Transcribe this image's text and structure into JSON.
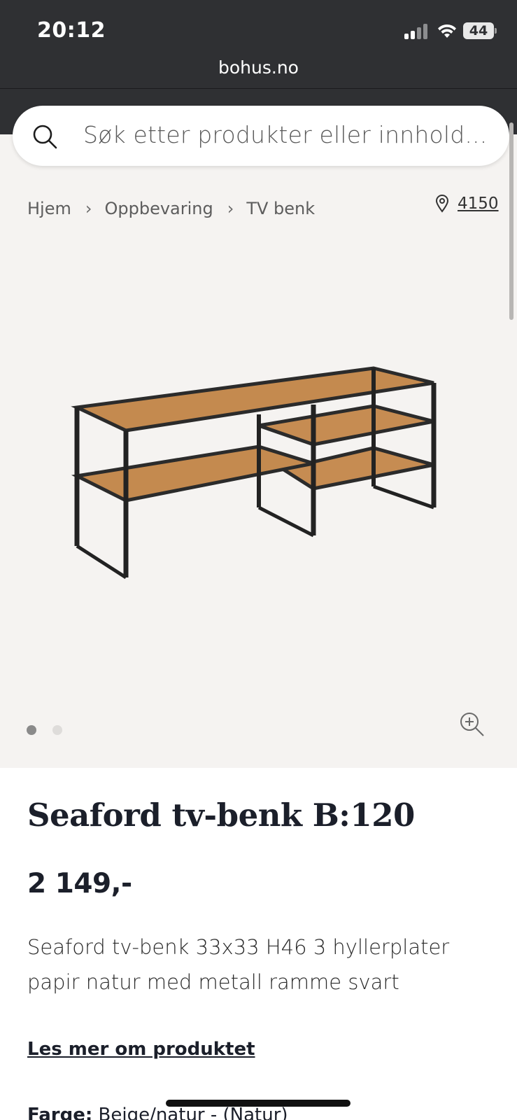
{
  "status_bar": {
    "time": "20:12",
    "battery": "44",
    "url": "bohus.no"
  },
  "search": {
    "placeholder": "Søk etter produkter eller innhold..."
  },
  "breadcrumb": {
    "items": [
      "Hjem",
      "Oppbevaring",
      "TV benk"
    ]
  },
  "location": {
    "postcode": "4150"
  },
  "gallery": {
    "image_count": 2,
    "active_index": 0
  },
  "product": {
    "title": "Seaford tv-benk B:120",
    "price": "2 149,-",
    "description": "Seaford tv-benk 33x33 H46 3 hyllerplater papir natur med metall ramme svart",
    "read_more": "Les mer om produktet",
    "color_label": "Farge:",
    "color_value": "Beige/natur - (Natur)"
  },
  "colors": {
    "header_bg": "#2f3033",
    "image_bg": "#f5f3f1",
    "text_dark": "#1b1f2a"
  }
}
